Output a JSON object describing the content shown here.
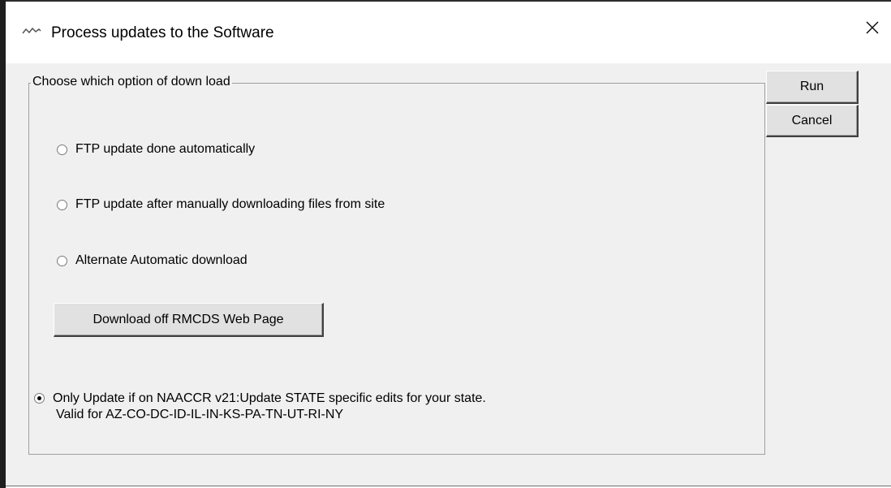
{
  "window": {
    "title": "Process updates to the Software",
    "app_icon": "app-wave-icon",
    "close_icon": "close-icon"
  },
  "group": {
    "label": "Choose which option of down load",
    "options": [
      {
        "label": "FTP update done automatically",
        "selected": false
      },
      {
        "label": "FTP update after manually downloading files from site",
        "selected": false
      },
      {
        "label": "Alternate Automatic download",
        "selected": false
      }
    ],
    "web_button": "Download off RMCDS Web Page",
    "state_option": {
      "line1": "Only Update if on NAACCR v21:Update STATE specific edits for your state.",
      "line2": "Valid for AZ-CO-DC-ID-IL-IN-KS-PA-TN-UT-RI-NY",
      "selected": true
    }
  },
  "actions": {
    "run": "Run",
    "cancel": "Cancel"
  },
  "colors": {
    "client_bg": "#f0f0f0",
    "button_bg": "#e1e1e1",
    "group_border": "#a0a0a0"
  }
}
